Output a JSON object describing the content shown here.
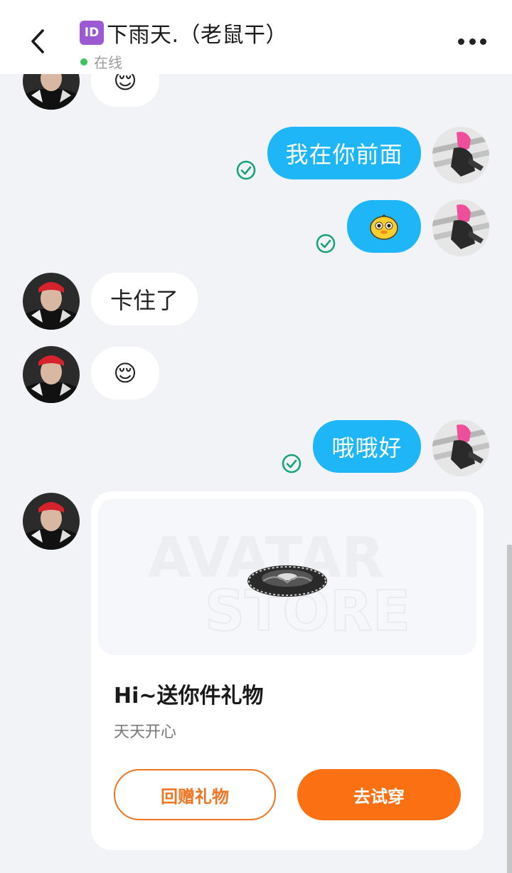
{
  "header": {
    "id_badge": "ID",
    "title": "下雨天.（老鼠干）",
    "status": "在线"
  },
  "messages": [
    {
      "side": "in",
      "emoji": "😌"
    },
    {
      "side": "out",
      "text": "我在你前面",
      "read": true
    },
    {
      "side": "out",
      "sticker": "yellow-duck-sticker",
      "read": true
    },
    {
      "side": "in",
      "text": "卡住了"
    },
    {
      "side": "in",
      "emoji": "😌"
    },
    {
      "side": "out",
      "text": "哦哦好",
      "read": true
    }
  ],
  "gift_card": {
    "banner_text_1": "AVATAR",
    "banner_text_2": "STORE",
    "title": "Hi~送你件礼物",
    "subtitle": "天天开心",
    "return_gift_label": "回赠礼物",
    "try_on_label": "去试穿"
  },
  "colors": {
    "outgoing_bubble": "#1fb6f8",
    "read_check": "#17a37a",
    "accent_orange": "#fa7013",
    "online": "#3ac55a"
  }
}
